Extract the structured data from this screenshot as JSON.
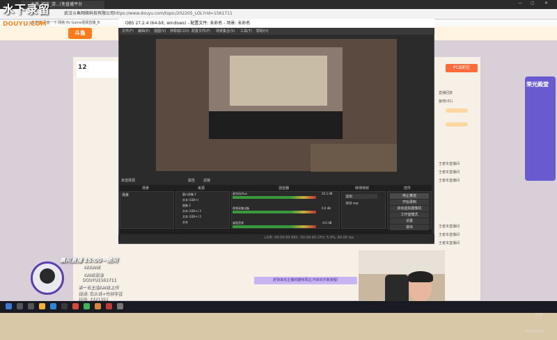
{
  "watermark": "水下录留",
  "douyu_mark": "DOUYU.COM",
  "browser": {
    "tab": "主播_游戏_游...(免直播平台",
    "site_label": "武汉斗鱼网络科技有限公司",
    "url": "https://www.douyu.com/topic/202205_LOL?rid=1561711",
    "bookmarks": "斗鱼直播  百度一下  网络 flv  Game视频直播_B"
  },
  "douyu": {
    "logo": "斗鱼",
    "room_num": "12",
    "pcb_btn": "PCB前往"
  },
  "obs": {
    "title": "OBS 27.2.4 (64-bit, windows) - 配置文件: 未命名 - 场景: 未命名",
    "menu": [
      "文件(F)",
      "编辑(E)",
      "视图(V)",
      "停靠窗口(D)",
      "配置文件(P)",
      "场景集合(S)",
      "工具(T)",
      "帮助(H)"
    ],
    "no_source_selected": "未选择源",
    "properties": "属性",
    "filters": "滤镜",
    "docks": {
      "scenes": "场景",
      "sources": "来源",
      "mixer": "混音器",
      "transitions": "转场特效",
      "controls": "控件"
    },
    "scene_name": "场景",
    "sources": [
      "窗口采集 2",
      "文本 (GDI+)",
      "图像 2",
      "文本 (GDI+) 3",
      "文本 (GDI+) 2",
      "文本"
    ],
    "mixer": [
      {
        "name": "麦克风/Aux",
        "db": "20.3 dB"
      },
      {
        "name": "视频采集设备",
        "db": "0.0 dB"
      },
      {
        "name": "桌面音频",
        "db": "-0.0 dB"
      }
    ],
    "transition": "淡出",
    "duration": "300 ms",
    "controls": [
      "停止推流",
      "开始录制",
      "启动虚拟摄像机",
      "工作室模式",
      "设置",
      "退出"
    ],
    "status": "LIVE: 00:00:00   REC: 00:00:00   CPU: 5.9%, 60.00 fps"
  },
  "right_panel": {
    "items": [
      "直播回放",
      "鱼吧(41)",
      "王者本直播间",
      "王者本直播间",
      "王者本直播间",
      "王者本直播间",
      "王者本直播间",
      "王者本直播间"
    ]
  },
  "side_ad": "荣光殿堂",
  "banner": "赶快来玩主播的趣味周边,开启欢乐新旅程!",
  "streamer": {
    "schedule": "晨间直播 15:00~晚间",
    "lines": [
      "KKKANE",
      "KANE影像",
      "DOUYU1561711",
      "第一名主播KANE上传",
      "微博: 石头哥+竹林宇宫",
      "抖音: 3321351"
    ]
  },
  "taskbar": {
    "time": "1:21",
    "date": "2022/6/13"
  },
  "colors": {
    "douyu_orange": "#ff7a1a",
    "obs_dark": "#2b2b2b",
    "side_purple": "#6a5ad0"
  }
}
